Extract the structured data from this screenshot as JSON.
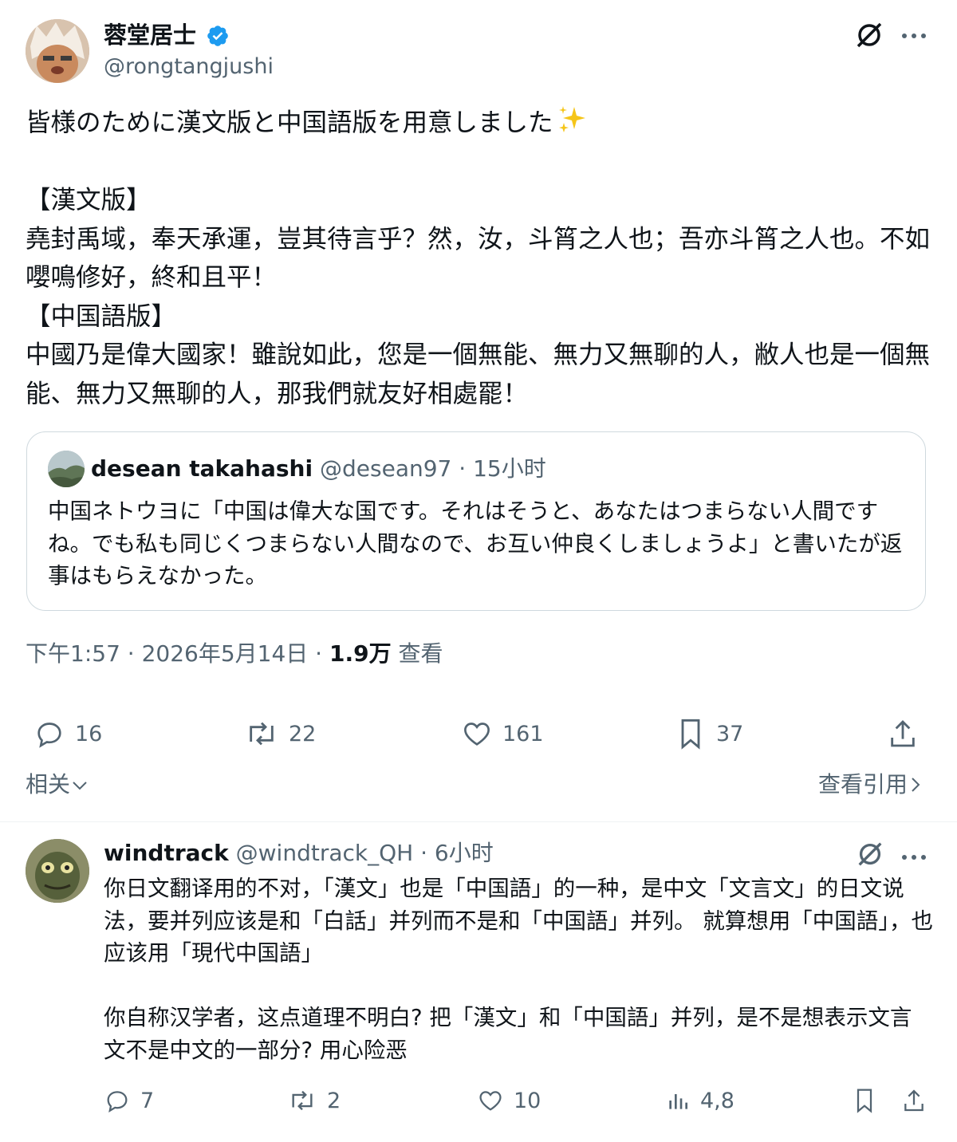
{
  "post": {
    "display_name": "蓉堂居士",
    "handle": "@rongtangjushi",
    "body": "皆様のために漢文版と中国語版を用意しました",
    "body_sections": "\n\n【漢文版】\n堯封禹域，奉天承運，豈其待言乎？然，汝，斗筲之人也；吾亦斗筲之人也。不如嚶鳴修好，終和且平！\n【中国語版】\n中國乃是偉大國家！雖說如此，您是一個無能、無力又無聊的人，敝人也是一個無能、無力又無聊的人，那我們就友好相處罷！",
    "icons": {
      "verified": "verified-badge-icon",
      "grok": "grok-icon",
      "more": "more-icon",
      "sparkle": "sparkles-emoji"
    }
  },
  "quote": {
    "name": "desean takahashi",
    "handle": "@desean97",
    "time": "15小时",
    "text": "中国ネトウヨに「中国は偉大な国です。それはそうと、あなたはつまらない人間ですね。でも私も同じくつまらない人間なので、お互い仲良くしましょうよ」と書いたが返事はもらえなかった。"
  },
  "meta": {
    "time": "下午1:57 · 2026年5月14日 · ",
    "views_count": "1.9万",
    "views_label": " 查看"
  },
  "actions": {
    "replies": "16",
    "reposts": "22",
    "likes": "161",
    "bookmarks": "37"
  },
  "related_label": "相关",
  "view_quotes_label": "查看引用",
  "reply": {
    "name": "windtrack",
    "handle": "@windtrack_QH",
    "time": "6小时",
    "text": "你日文翻译用的不对，「漢文」也是「中国語」的一种，是中文「文言文」的日文说法，要并列应该是和「白話」并列而不是和「中国語」并列。 就算想用「中国語」，也应该用「現代中国語」\n\n你自称汉学者，这点道理不明白? 把「漢文」和「中国語」并列，是不是想表示文言文不是中文的一部分? 用心险恶",
    "replies": "7",
    "reposts": "2",
    "likes": "10",
    "views": "4,8"
  },
  "colors": {
    "text": "#0f1419",
    "secondary": "#536471",
    "verified": "#1d9bf0",
    "border": "#cfd9de"
  }
}
